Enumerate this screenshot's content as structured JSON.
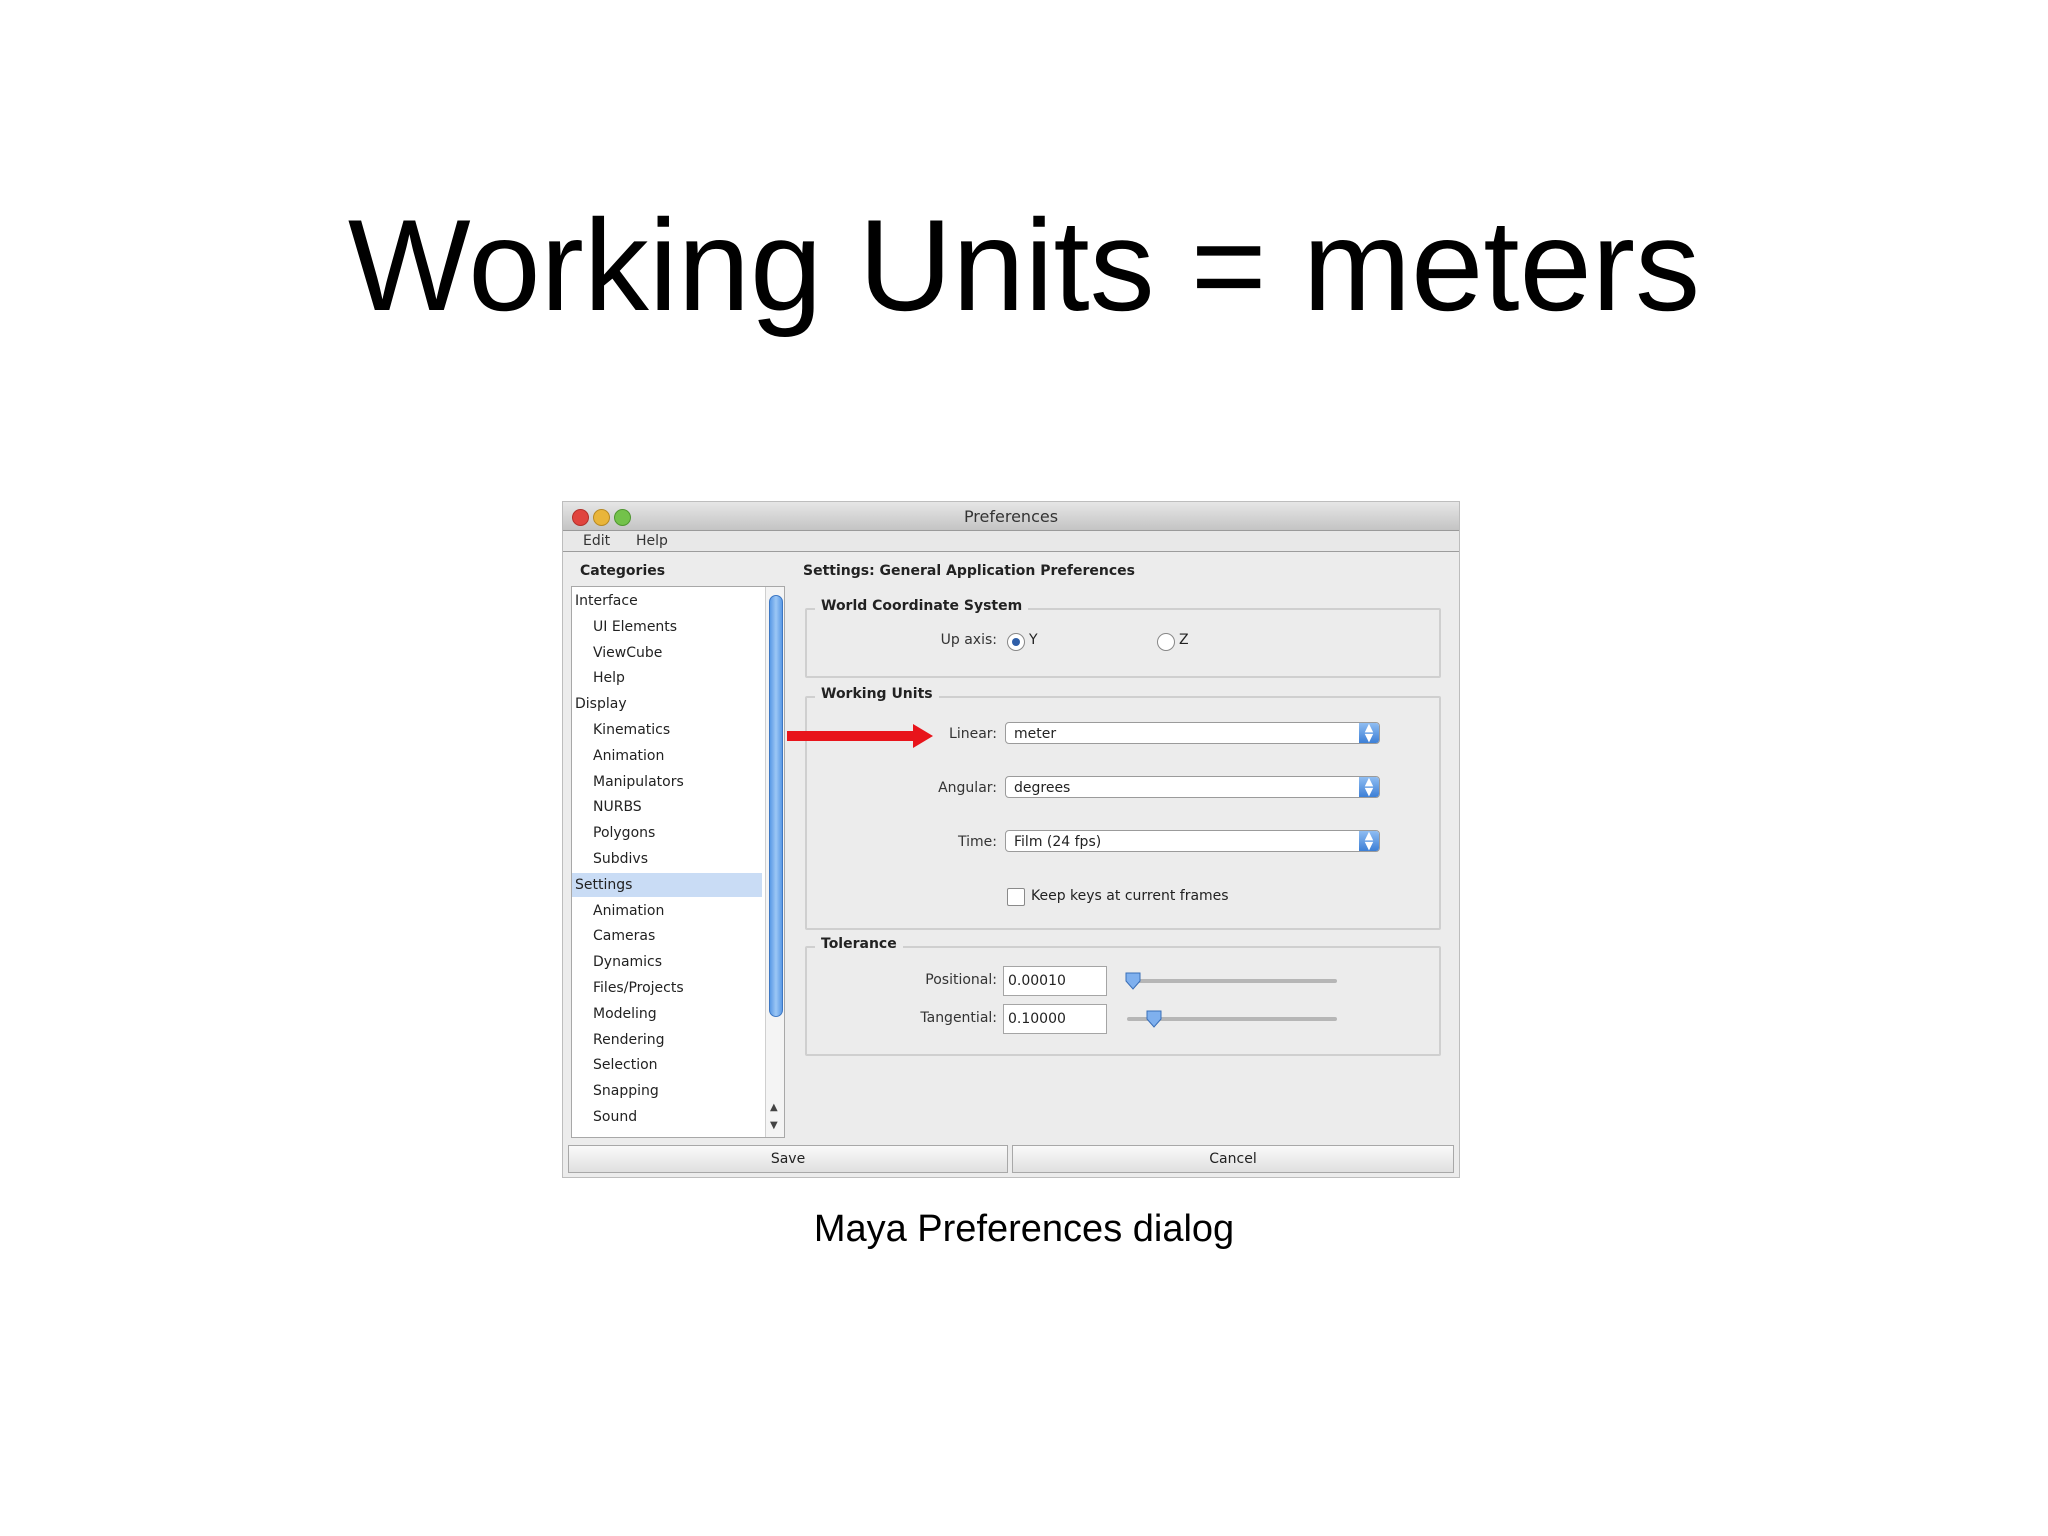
{
  "slide": {
    "title": "Working Units = meters",
    "caption": "Maya Preferences dialog"
  },
  "dialog": {
    "window_title": "Preferences",
    "menu": [
      "Edit",
      "Help"
    ],
    "categories_label": "Categories",
    "categories": [
      {
        "label": "Interface",
        "level": 0,
        "selected": false
      },
      {
        "label": "UI Elements",
        "level": 1,
        "selected": false
      },
      {
        "label": "ViewCube",
        "level": 1,
        "selected": false
      },
      {
        "label": "Help",
        "level": 1,
        "selected": false
      },
      {
        "label": "Display",
        "level": 0,
        "selected": false
      },
      {
        "label": "Kinematics",
        "level": 1,
        "selected": false
      },
      {
        "label": "Animation",
        "level": 1,
        "selected": false
      },
      {
        "label": "Manipulators",
        "level": 1,
        "selected": false
      },
      {
        "label": "NURBS",
        "level": 1,
        "selected": false
      },
      {
        "label": "Polygons",
        "level": 1,
        "selected": false
      },
      {
        "label": "Subdivs",
        "level": 1,
        "selected": false
      },
      {
        "label": "Settings",
        "level": 0,
        "selected": true
      },
      {
        "label": "Animation",
        "level": 1,
        "selected": false
      },
      {
        "label": "Cameras",
        "level": 1,
        "selected": false
      },
      {
        "label": "Dynamics",
        "level": 1,
        "selected": false
      },
      {
        "label": "Files/Projects",
        "level": 1,
        "selected": false
      },
      {
        "label": "Modeling",
        "level": 1,
        "selected": false
      },
      {
        "label": "Rendering",
        "level": 1,
        "selected": false
      },
      {
        "label": "Selection",
        "level": 1,
        "selected": false
      },
      {
        "label": "Snapping",
        "level": 1,
        "selected": false
      },
      {
        "label": "Sound",
        "level": 1,
        "selected": false
      }
    ],
    "settings_header": "Settings: General Application Preferences",
    "world_coordinate": {
      "title": "World Coordinate System",
      "up_axis_label": "Up axis:",
      "options": [
        "Y",
        "Z"
      ],
      "selected": "Y"
    },
    "working_units": {
      "title": "Working Units",
      "linear_label": "Linear:",
      "linear_value": "meter",
      "angular_label": "Angular:",
      "angular_value": "degrees",
      "time_label": "Time:",
      "time_value": "Film (24 fps)",
      "keep_keys_label": "Keep keys at current frames",
      "keep_keys_checked": false
    },
    "tolerance": {
      "title": "Tolerance",
      "positional_label": "Positional:",
      "positional_value": "0.00010",
      "positional_level": 0.03,
      "tangential_label": "Tangential:",
      "tangential_value": "0.10000",
      "tangential_level": 0.13
    },
    "buttons": {
      "save": "Save",
      "cancel": "Cancel"
    },
    "accent_color": "#e8141b"
  }
}
